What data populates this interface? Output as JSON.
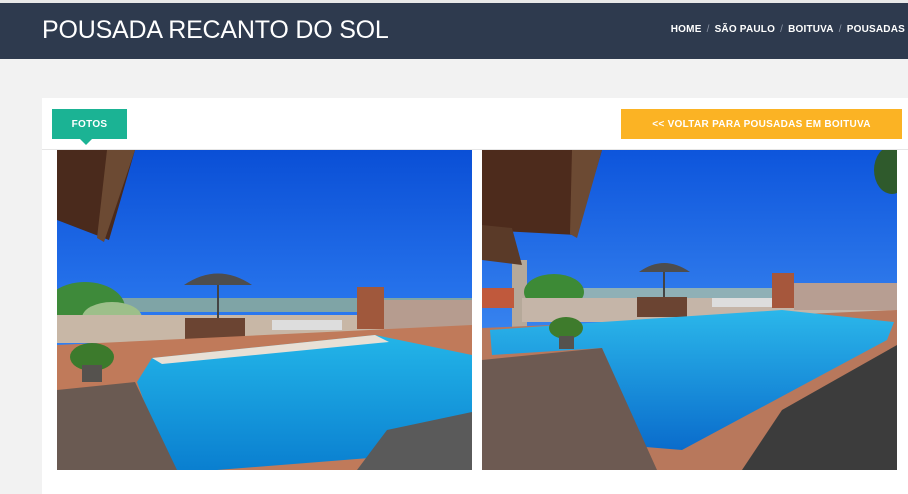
{
  "header": {
    "title": "POUSADA RECANTO DO SOL",
    "breadcrumb": [
      "HOME",
      "SÃO PAULO",
      "BOITUVA",
      "POUSADAS"
    ]
  },
  "tabs": {
    "photos_label": "FOTOS"
  },
  "actions": {
    "back_label": "<< VOLTAR PARA POUSADAS EM BOITUVA"
  },
  "colors": {
    "header_bg": "#2e3a4e",
    "tab_active": "#1bb394",
    "back_button": "#fbb324"
  },
  "gallery": {
    "photos": [
      {
        "subject": "pool-photo"
      },
      {
        "subject": "pool-photo"
      }
    ]
  }
}
